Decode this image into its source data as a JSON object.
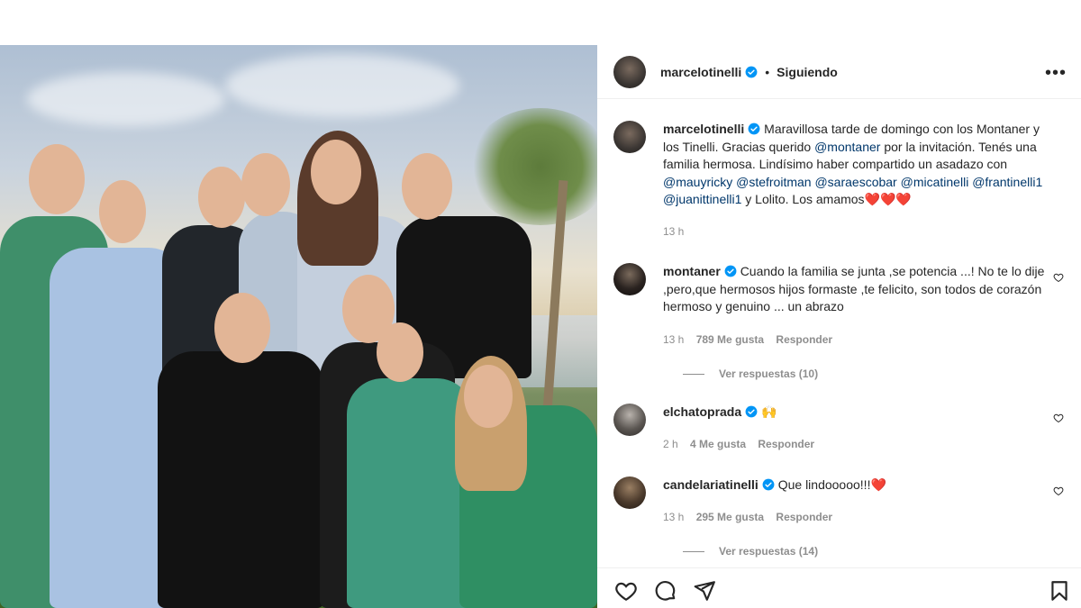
{
  "post": {
    "username": "marcelotinelli",
    "separator": "•",
    "follow_status": "Siguiendo",
    "more_label": "•••"
  },
  "caption": {
    "username": "marcelotinelli",
    "text_1": "Maravillosa tarde de domingo con los Montaner y los Tinelli. Gracias querido ",
    "mention_1": "@montaner",
    "text_2": " por la invitación. Tenés una familia hermosa. Lindísimo haber compartido un asadazo con ",
    "mention_2": "@mauyricky",
    "mention_3": "@stefroitman",
    "mention_4": "@saraescobar",
    "mention_5": "@micatinelli",
    "mention_6": "@frantinelli1",
    "mention_7": "@juanittinelli1",
    "text_3": " y Lolito. Los amamos",
    "hearts": "❤️❤️❤️",
    "time": "13 h"
  },
  "comments": [
    {
      "username": "montaner",
      "text": "Cuando la familia se junta ,se potencia ...! No te lo dije ,pero,que hermosos hijos formaste ,te felicito, son todos de corazón hermoso y genuino ... un abrazo",
      "time": "13 h",
      "likes": "789 Me gusta",
      "reply": "Responder",
      "view_replies": "Ver respuestas (10)"
    },
    {
      "username": "elchatoprada",
      "text": "🙌",
      "time": "2 h",
      "likes": "4 Me gusta",
      "reply": "Responder"
    },
    {
      "username": "candelariatinelli",
      "text": "Que lindooooo!!!",
      "heart": "❤️",
      "time": "13 h",
      "likes": "295 Me gusta",
      "reply": "Responder",
      "view_replies": "Ver respuestas (14)"
    }
  ],
  "colors": {
    "verified": "#0095f6",
    "mention": "#00376b",
    "muted": "#8e8e8e",
    "heart": "#ed1d24"
  }
}
